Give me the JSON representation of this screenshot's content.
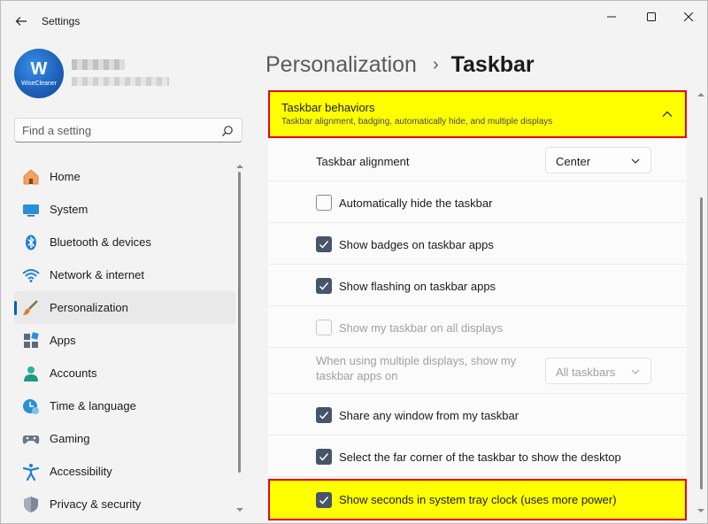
{
  "window": {
    "title": "Settings"
  },
  "profile": {
    "avatar_letter": "W",
    "avatar_brand": "WiseCleaner"
  },
  "search": {
    "placeholder": "Find a setting"
  },
  "sidebar": {
    "items": [
      {
        "label": "Home",
        "icon": "home-icon"
      },
      {
        "label": "System",
        "icon": "system-icon"
      },
      {
        "label": "Bluetooth & devices",
        "icon": "bluetooth-icon"
      },
      {
        "label": "Network & internet",
        "icon": "wifi-icon"
      },
      {
        "label": "Personalization",
        "icon": "brush-icon",
        "selected": true
      },
      {
        "label": "Apps",
        "icon": "apps-icon"
      },
      {
        "label": "Accounts",
        "icon": "accounts-icon"
      },
      {
        "label": "Time & language",
        "icon": "clock-globe-icon"
      },
      {
        "label": "Gaming",
        "icon": "gamepad-icon"
      },
      {
        "label": "Accessibility",
        "icon": "accessibility-icon"
      },
      {
        "label": "Privacy & security",
        "icon": "shield-icon"
      }
    ]
  },
  "breadcrumb": {
    "parent": "Personalization",
    "separator": "›",
    "current": "Taskbar"
  },
  "section": {
    "title": "Taskbar behaviors",
    "subtitle": "Taskbar alignment, badging, automatically hide, and multiple displays"
  },
  "settings": {
    "alignment_label": "Taskbar alignment",
    "alignment_value": "Center",
    "auto_hide": {
      "label": "Automatically hide the taskbar",
      "checked": false
    },
    "badges": {
      "label": "Show badges on taskbar apps",
      "checked": true
    },
    "flashing": {
      "label": "Show flashing on taskbar apps",
      "checked": true
    },
    "all_displays": {
      "label": "Show my taskbar on all displays",
      "checked": false,
      "disabled": true
    },
    "multi_display_label": "When using multiple displays, show my taskbar apps on",
    "multi_display_value": "All taskbars",
    "share_window": {
      "label": "Share any window from my taskbar",
      "checked": true
    },
    "far_corner": {
      "label": "Select the far corner of the taskbar to show the desktop",
      "checked": true
    },
    "show_seconds": {
      "label": "Show seconds in system tray clock (uses more power)",
      "checked": true
    }
  },
  "colors": {
    "highlight": "#ffff00",
    "highlight_border": "#e8001c",
    "accent": "#005fb8",
    "checkbox_on": "#475568"
  }
}
